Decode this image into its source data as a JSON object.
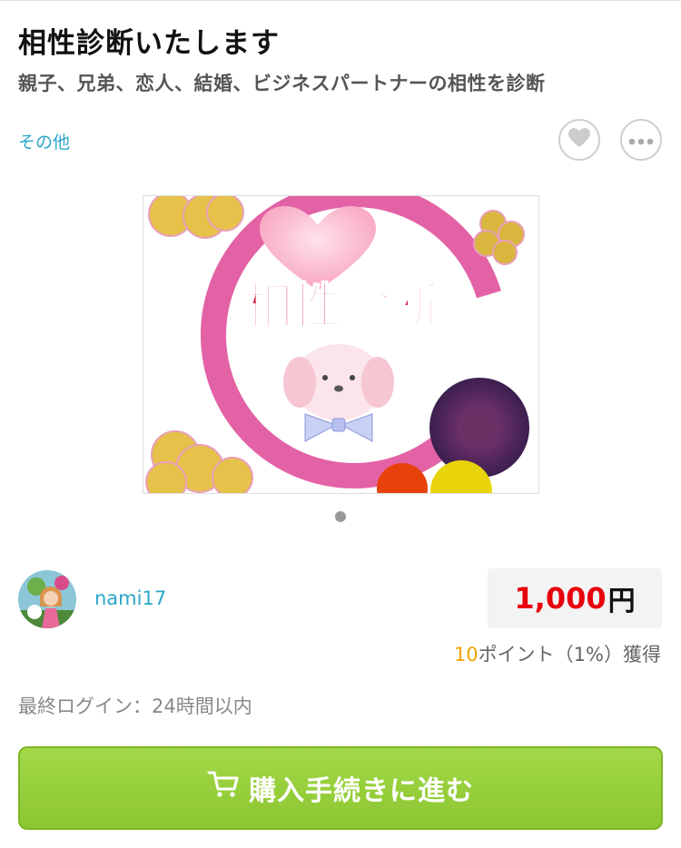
{
  "title": "相性診断いたします",
  "subtitle": "親子、兄弟、恋人、結婚、ビジネスパートナーの相性を診断",
  "category": "その他",
  "icons": {
    "favorite": "heart-icon",
    "more": "more-dots-icon",
    "cart": "cart-icon"
  },
  "product_image": {
    "text": "相性診断"
  },
  "carousel": {
    "total": 1,
    "current": 1
  },
  "seller": {
    "name": "nami17"
  },
  "price": {
    "amount": "1,000",
    "unit": "円"
  },
  "points": {
    "amount": "10",
    "text": "ポイント（1%）獲得"
  },
  "last_login": "最終ログイン：24時間以内",
  "buy_button": {
    "label": "購入手続きに進む"
  },
  "colors": {
    "accent": "#2ba6c9",
    "price": "#e8000b",
    "button": "#8cc631",
    "points": "#f0a400"
  }
}
